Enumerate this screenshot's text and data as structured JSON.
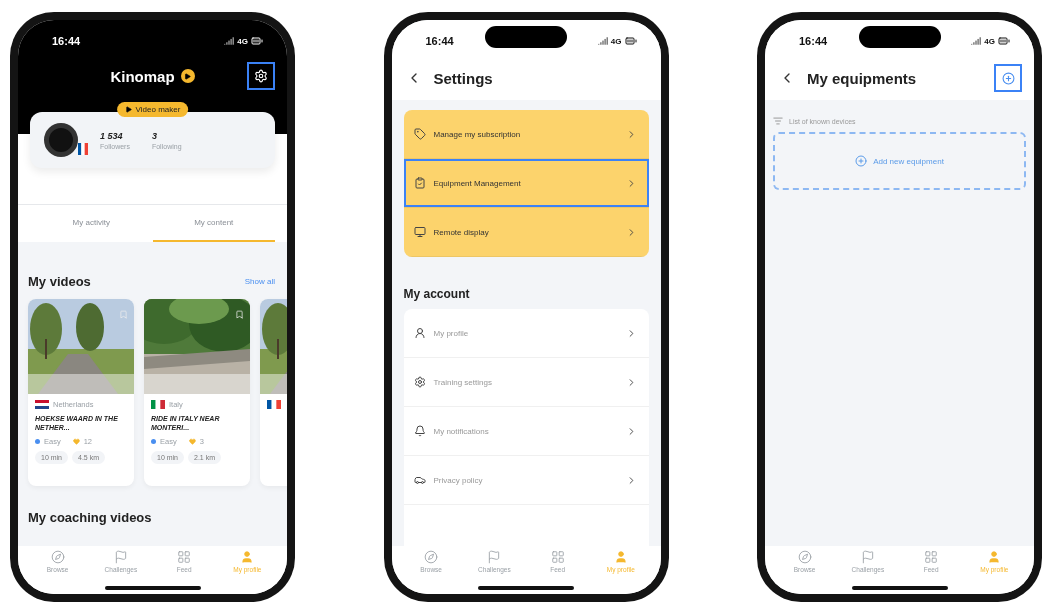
{
  "phones": [
    {
      "kind": "profile",
      "dark_header": true,
      "status": {
        "time": "16:44",
        "network": "4G"
      },
      "title": "Kinomap",
      "settings_button": {
        "highlighted": true
      },
      "badge": "Video maker",
      "stats": [
        {
          "value": "1 534",
          "label": "Followers"
        },
        {
          "value": "3",
          "label": "Following"
        }
      ],
      "tabs": [
        {
          "label": "My activity",
          "selected": false
        },
        {
          "label": "My content",
          "selected": true
        }
      ],
      "section": {
        "title": "My videos",
        "link": "Show all"
      },
      "videos": [
        {
          "kind": "video",
          "country": "Netherlands",
          "title": "HOEKSE WAARD IN THE NETHER...",
          "difficulty": "Easy",
          "likes": "12",
          "duration": "10 min",
          "distance": "4.5 km"
        },
        {
          "kind": "video",
          "country": "Italy",
          "title": "RIDE IN ITALY NEAR MONTERI...",
          "difficulty": "Easy",
          "likes": "3",
          "duration": "10 min",
          "distance": "2.1 km"
        },
        {
          "kind": "cut_off"
        }
      ],
      "next_section": "My coaching videos",
      "nav": [
        {
          "label": "Browse",
          "selected": false
        },
        {
          "label": "Challenges",
          "selected": false
        },
        {
          "label": "Feed",
          "selected": false
        },
        {
          "label": "My profile",
          "selected": true
        }
      ]
    },
    {
      "kind": "settings",
      "dark_header": false,
      "status": {
        "time": "16:44",
        "network": "4G"
      },
      "title": "Settings",
      "groups": [
        {
          "kind": "highlight",
          "items": [
            {
              "label": "Manage my subscription",
              "highlighted": false
            },
            {
              "label": "Equipment Management",
              "highlighted": true
            },
            {
              "label": "Remote display",
              "highlighted": false
            }
          ]
        },
        {
          "kind": "plain",
          "title": "My account",
          "items": [
            {
              "label": "My profile",
              "highlighted": false
            },
            {
              "label": "Training settings",
              "highlighted": false
            },
            {
              "label": "My notifications",
              "highlighted": false
            },
            {
              "label": "Privacy policy",
              "highlighted": false
            }
          ]
        }
      ],
      "nav": [
        {
          "label": "Browse",
          "selected": false
        },
        {
          "label": "Challenges",
          "selected": false
        },
        {
          "label": "Feed",
          "selected": false
        },
        {
          "label": "My profile",
          "selected": true
        }
      ]
    },
    {
      "kind": "equipment",
      "dark_header": false,
      "status": {
        "time": "16:44",
        "network": "4G"
      },
      "title": "My equipments",
      "add_button": {
        "highlighted": true
      },
      "list_label": "List of known devices",
      "add_equipment": "Add new equipment",
      "nav": [
        {
          "label": "Browse",
          "selected": false
        },
        {
          "label": "Challenges",
          "selected": false
        },
        {
          "label": "Feed",
          "selected": false
        },
        {
          "label": "My profile",
          "selected": true
        }
      ]
    }
  ]
}
